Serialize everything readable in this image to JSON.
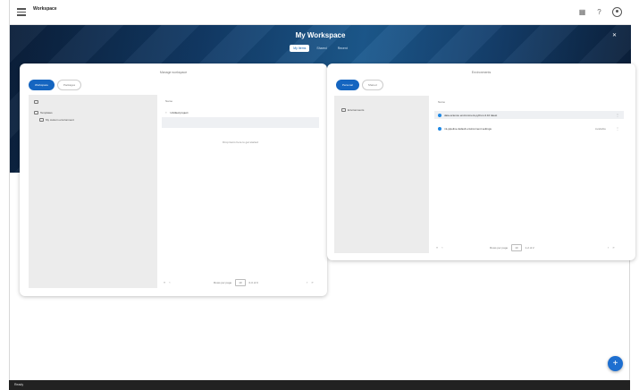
{
  "app": {
    "title": "Workspace"
  },
  "topbar": {
    "icons": [
      "grid-icon",
      "help-icon",
      "profile-icon"
    ]
  },
  "workspace": {
    "title": "My Workspace",
    "tabs": [
      {
        "label": "My Items",
        "active": true
      },
      {
        "label": "Shared",
        "active": false
      },
      {
        "label": "Recent",
        "active": false
      }
    ]
  },
  "left_panel": {
    "title": "Manage workspace",
    "toggle": [
      "Workspace",
      "Packages"
    ],
    "tree": [
      {
        "label": "",
        "icon": "folder-icon"
      },
      {
        "label": "Templates",
        "icon": "folder-icon"
      },
      {
        "label": "My custom environment",
        "icon": "file-icon"
      }
    ],
    "column_header": "Name",
    "rows": [
      {
        "label": "Untitled project",
        "icon": "file-icon",
        "selected": false
      }
    ],
    "empty_message": "Drop items here to get started",
    "pager": {
      "label": "Rows per page",
      "value": "10",
      "range": "0-0 of 0"
    }
  },
  "right_panel": {
    "title": "Environments",
    "toggle": [
      "Personal",
      "Shared"
    ],
    "tree": [
      {
        "label": "Environments",
        "icon": "folder-icon"
      }
    ],
    "column_header": "Name",
    "rows": [
      {
        "label": "data-science environment-python-3.10 latest",
        "meta": "",
        "selected": true
      },
      {
        "label": "ml-pipeline default environment settings",
        "meta": "Available",
        "selected": false
      }
    ],
    "pager": {
      "label": "Rows per page",
      "value": "10",
      "range": "1-2 of 2"
    }
  },
  "fab": {
    "label": "+"
  },
  "statusbar": {
    "text": "Ready"
  }
}
